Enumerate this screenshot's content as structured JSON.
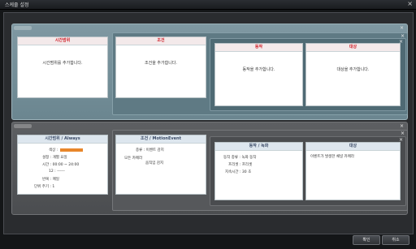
{
  "window": {
    "title": "스케줄 설정",
    "close_glyph": "×"
  },
  "block_close_glyph": "×",
  "rule1": {
    "time_panel": {
      "header": "시간범위",
      "body": "시간범위를 추가합니다."
    },
    "condition_panel": {
      "header": "조건",
      "body": "조건을 추가합니다."
    },
    "action_panel": {
      "header": "동작",
      "body": "동작을 추가합니다."
    },
    "target_panel": {
      "header": "대상",
      "body": "대상을 추가합니다."
    }
  },
  "rule2": {
    "time_panel": {
      "header": "시간범위 / Always",
      "lines": [
        "색상 :",
        "설정 : 개별 요일",
        "시간 : 00:00 ~ 24:00",
        "12 : ------",
        "반복 : 매일",
        "단위 주기 : 1"
      ]
    },
    "condition_panel": {
      "header": "조건 / MotionEvent",
      "lines": [
        "종류 : 이벤트 감지",
        "모든 카메라",
        "움직임 감지"
      ]
    },
    "action_panel": {
      "header": "동작 / 녹화",
      "lines": [
        "동작 종류 : 녹화 동작",
        "프리셋 : 프리셋",
        "지속시간 : 30 초"
      ]
    },
    "target_panel": {
      "header": "대상",
      "lines": [
        "이벤트가 발생한 채널 카메라"
      ]
    }
  },
  "footer": {
    "ok_label": "확인",
    "cancel_label": "취소"
  },
  "colors": {
    "accent_red": "#d0202a",
    "color_swatch": "#e8862a",
    "rule1_bg": "#7f98a2",
    "rule2_bg": "#5d5f62"
  }
}
